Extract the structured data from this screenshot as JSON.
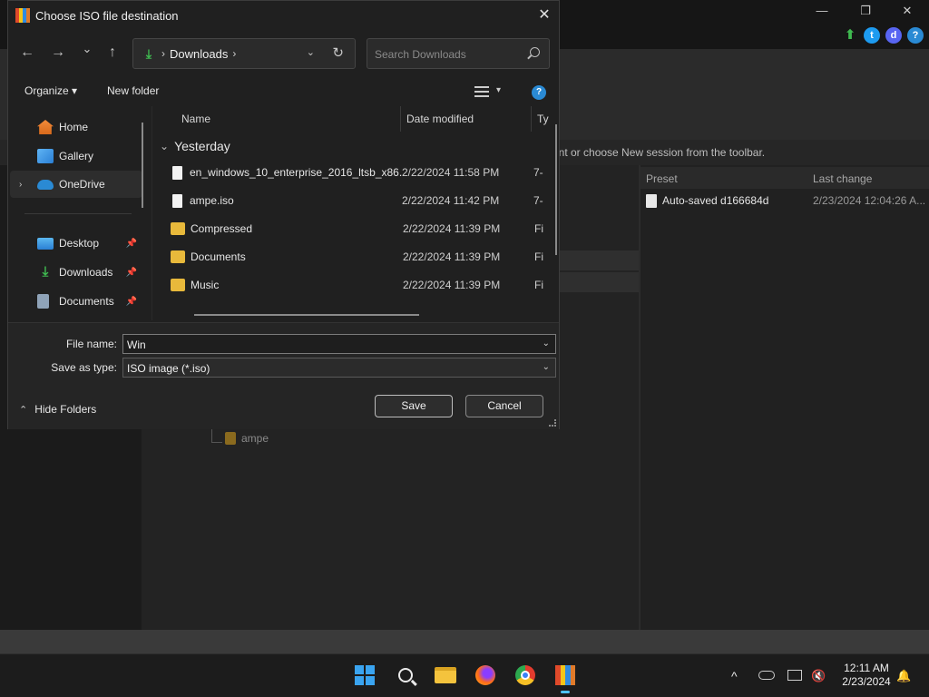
{
  "background_app": {
    "window_controls": {
      "minimize": "—",
      "maximize": "❐",
      "close": "✕"
    },
    "message": "rent or choose New session from the toolbar.",
    "sessions": {
      "columns": [
        "Preset",
        "Last change"
      ],
      "rows": [
        {
          "preset": "Auto-saved d166684d",
          "last_change": "2/23/2024 12:04:26 A..."
        }
      ]
    },
    "tree_item": "ampe"
  },
  "dialog": {
    "title": "Choose ISO file destination",
    "close": "✕",
    "nav": {
      "back": "←",
      "forward": "→",
      "recent": "⌄",
      "up": "↑"
    },
    "address": {
      "location": "Downloads",
      "separator": "›",
      "drop": "⌄",
      "refresh": "↻"
    },
    "search": {
      "placeholder": "Search Downloads"
    },
    "commands": {
      "organize": "Organize ▾",
      "new_folder": "New folder",
      "view_drop": "▾",
      "help": "?"
    },
    "sidebar": {
      "items": [
        {
          "label": "Home",
          "pin": ""
        },
        {
          "label": "Gallery",
          "pin": ""
        },
        {
          "label": "OneDrive",
          "chevron": "›"
        },
        {
          "label": "Desktop",
          "pin": "📌"
        },
        {
          "label": "Downloads",
          "pin": "📌"
        },
        {
          "label": "Documents",
          "pin": "📌"
        }
      ]
    },
    "files": {
      "columns": {
        "name": "Name",
        "date": "Date modified",
        "type": "Ty"
      },
      "group": {
        "chevron": "⌄",
        "label": "Yesterday"
      },
      "rows": [
        {
          "name": "en_windows_10_enterprise_2016_ltsb_x86...",
          "date": "2/22/2024 11:58 PM",
          "type": "7-",
          "icon": "doc"
        },
        {
          "name": "ampe.iso",
          "date": "2/22/2024 11:42 PM",
          "type": "7-",
          "icon": "doc"
        },
        {
          "name": "Compressed",
          "date": "2/22/2024 11:39 PM",
          "type": "Fi",
          "icon": "folder"
        },
        {
          "name": "Documents",
          "date": "2/22/2024 11:39 PM",
          "type": "Fi",
          "icon": "folder"
        },
        {
          "name": "Music",
          "date": "2/22/2024 11:39 PM",
          "type": "Fi",
          "icon": "folder"
        }
      ]
    },
    "form": {
      "file_name_label": "File name:",
      "file_name_value": "Win",
      "save_type_label": "Save as type:",
      "save_type_value": "ISO image (*.iso)",
      "drop": "⌄",
      "hide_folders": "Hide Folders",
      "hide_chevron": "⌃",
      "save": "Save",
      "cancel": "Cancel"
    }
  },
  "taskbar": {
    "clock_time": "12:11 AM",
    "clock_date": "2/23/2024",
    "tray": {
      "chevron": "^",
      "bell": "🔔"
    }
  },
  "colors": {
    "accent": "#4cc2ff",
    "folder": "#e8b93b",
    "download_green": "#3fb950"
  }
}
